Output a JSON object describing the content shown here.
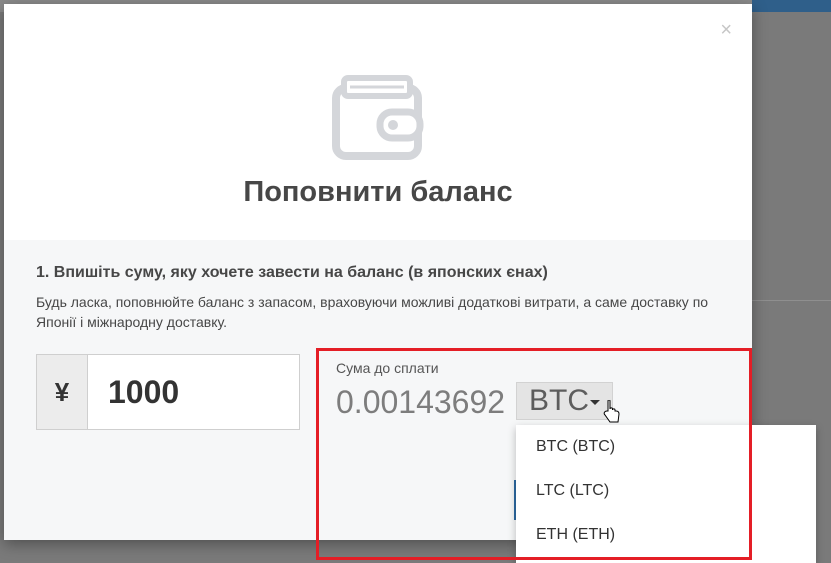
{
  "modal": {
    "close_label": "×",
    "title": "Поповнити баланс",
    "icon": "wallet-icon"
  },
  "step1": {
    "heading": "1. Впишіть суму, яку хочете завести на баланс (в японских єнах)",
    "hint": "Будь ласка, поповнюйте баланс з запасом, враховуючи можливі додаткові витрати, а саме доставку по Японії і міжнародну доставку."
  },
  "amount": {
    "currency_symbol": "¥",
    "value": "1000"
  },
  "payment": {
    "label": "Сума до сплати",
    "value": "0.00143692",
    "selected_currency": "BTC"
  },
  "currency_options": [
    "BTC (BTC)",
    "LTC (LTC)",
    "ETH (ETH)"
  ],
  "colors": {
    "highlight": "#e41e26",
    "primary": "#2d6aa3",
    "body_bg": "#f6f7f8"
  }
}
